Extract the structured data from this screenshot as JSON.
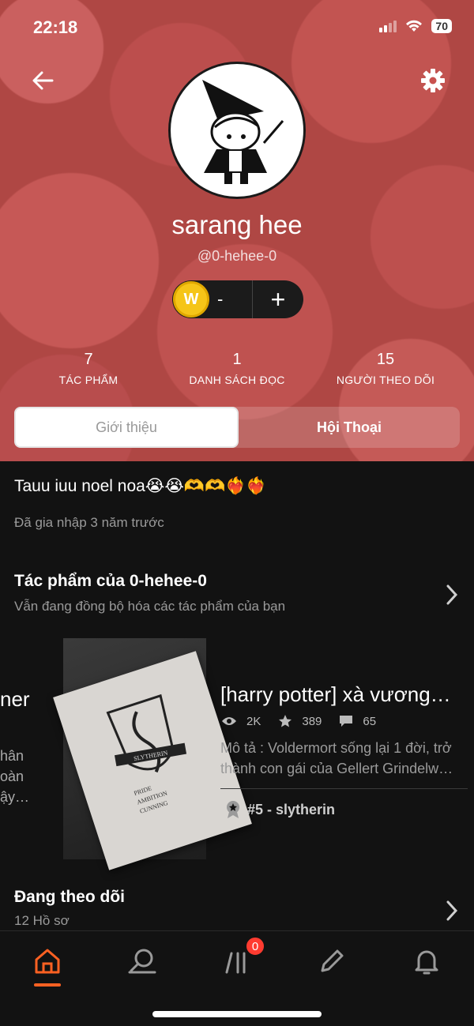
{
  "status_bar": {
    "time": "22:18",
    "battery": "70"
  },
  "profile": {
    "username": "sarang hee",
    "handle": "@0-hehee-0",
    "coin_value": "-",
    "coin_symbol": "W",
    "plus_label": "+"
  },
  "stats": [
    {
      "value": "7",
      "label": "TÁC PHẨM"
    },
    {
      "value": "1",
      "label": "DANH SÁCH ĐỌC"
    },
    {
      "value": "15",
      "label": "NGƯỜI THEO DÕI"
    }
  ],
  "tabs": [
    {
      "label": "Giới thiệu",
      "active": true
    },
    {
      "label": "Hội Thoại",
      "active": false
    }
  ],
  "bio": "Tauu iuu noel noa😭😭🫶🫶❤️‍🔥❤️‍🔥",
  "joined": "Đã gia nhập 3 năm trước",
  "works_section": {
    "title": "Tác phẩm của 0-hehee-0",
    "subtitle": "Vẫn đang đồng bộ hóa các tác phẩm của bạn"
  },
  "left_card_fragment": {
    "title": "ner",
    "lines": [
      "hân",
      "oàn",
      "ậy…"
    ]
  },
  "book": {
    "title": "[harry potter] xà vương…",
    "views": "2K",
    "votes": "389",
    "comments": "65",
    "description": "Mô tả : Voldermort sống lại 1 đời, trở thành con gái của Gellert Grindelw…",
    "rank": "#5 - slytherin",
    "cover_text": [
      "SLYTHERIN",
      "PRIDE",
      "AMBITION",
      "CUNNING"
    ]
  },
  "following_section": {
    "title": "Đang theo dõi",
    "subtitle": "12 Hồ sơ"
  },
  "nav": {
    "items": [
      "home-icon",
      "search-icon",
      "library-icon",
      "write-icon",
      "notifications-icon"
    ],
    "library_badge": "0",
    "accent": "#ff6122"
  }
}
